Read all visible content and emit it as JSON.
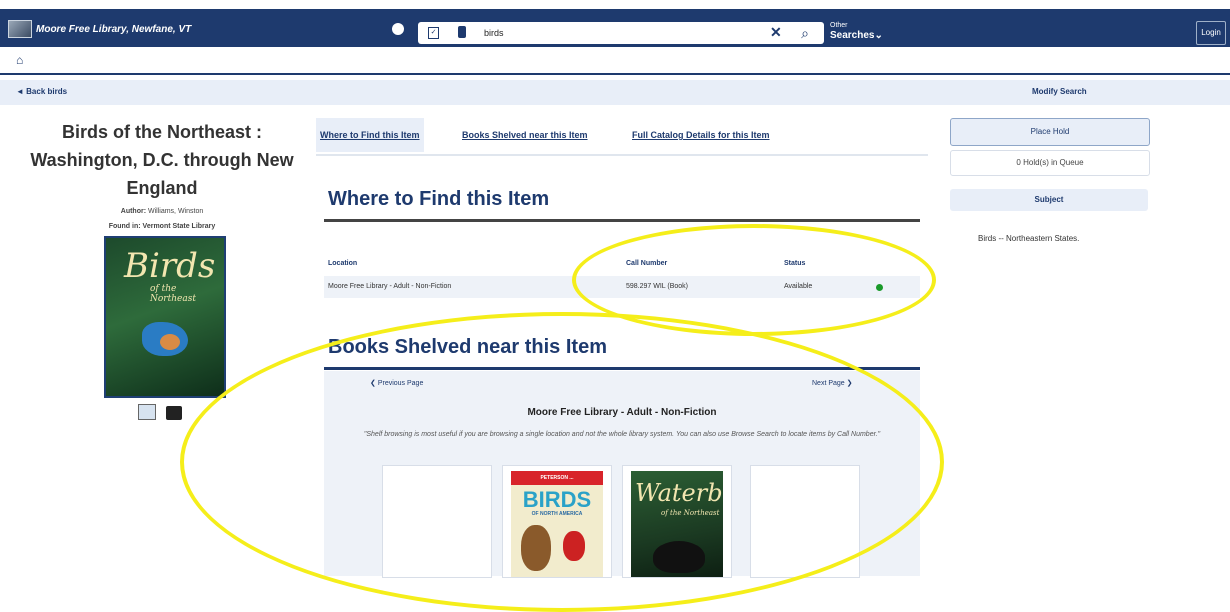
{
  "header": {
    "library_name": "Moore Free Library, Newfane, VT",
    "search_value": "birds",
    "other_searches_small": "Other",
    "other_searches_label": "Searches",
    "login_label": "Login"
  },
  "breadcrumb": {
    "back_label": "Back birds",
    "modify_label": "Modify Search"
  },
  "item": {
    "title": "Birds of the Northeast : Washington, D.C. through New England",
    "author_label": "Author:",
    "author": "Williams, Winston",
    "found_in_label": "Found in:",
    "found_in": "Vermont State Library",
    "cover_title": "Birds",
    "cover_subtitle": "of the Northeast"
  },
  "tabs": [
    {
      "label": "Where to Find this Item",
      "active": true
    },
    {
      "label": "Books Shelved near this Item",
      "active": false
    },
    {
      "label": "Full Catalog Details for this Item",
      "active": false
    }
  ],
  "where": {
    "heading": "Where to Find this Item",
    "columns": [
      "Location",
      "Call Number",
      "Status"
    ],
    "rows": [
      {
        "location": "Moore Free Library - Adult - Non-Fiction",
        "call_number": "598.297 WIL (Book)",
        "status": "Available",
        "status_color": "#1a9a2a"
      }
    ]
  },
  "shelf": {
    "heading": "Books Shelved near this Item",
    "prev_label": "Previous Page",
    "next_label": "Next Page",
    "location": "Moore Free Library - Adult - Non-Fiction",
    "note": "\"Shelf browsing is most useful if you are browsing a single location and not the whole library system. You can also use Browse Search to locate items by Call Number.\"",
    "books": [
      {
        "cover": ""
      },
      {
        "cover_band": "PETERSON ...",
        "cover_title": "BIRDS",
        "cover_subtitle": "OF NORTH AMERICA"
      },
      {
        "cover_title": "Waterbirds",
        "cover_subtitle": "of the Northeast"
      },
      {
        "cover": ""
      }
    ]
  },
  "sidebar": {
    "place_hold_label": "Place Hold",
    "holds_label": "0 Hold(s) in Queue",
    "subject_heading": "Subject",
    "subject_value": "Birds -- Northeastern States."
  },
  "colors": {
    "brand": "#1e3a6e",
    "panel": "#e8eef8",
    "annotation": "#f5ee1a",
    "available": "#1a9a2a"
  }
}
